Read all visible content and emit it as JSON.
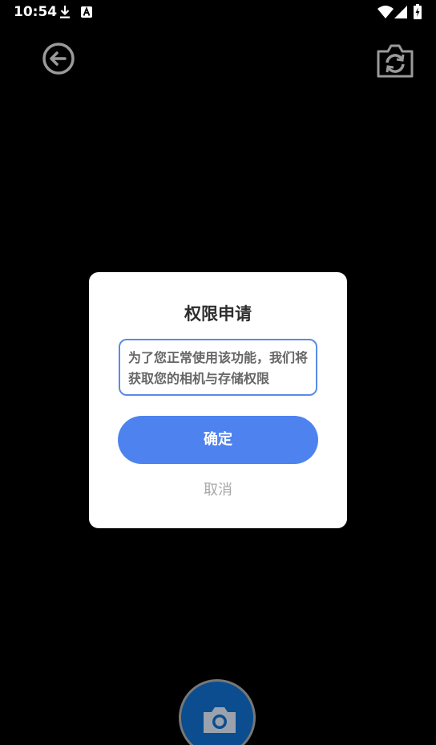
{
  "status_bar": {
    "time": "10:54",
    "icons": [
      "download-icon",
      "a-notification-icon",
      "wifi-icon",
      "signal-icon",
      "battery-charging-icon"
    ]
  },
  "camera": {
    "back_icon": "back-arrow-icon",
    "switch_icon": "camera-switch-icon",
    "shutter_icon": "camera-icon",
    "shutter_color": "#0b4d8f"
  },
  "dialog": {
    "title": "权限申请",
    "message": "为了您正常使用该功能，我们将获取您的相机与存储权限",
    "confirm_label": "确定",
    "cancel_label": "取消",
    "accent_color": "#4e83ef"
  }
}
